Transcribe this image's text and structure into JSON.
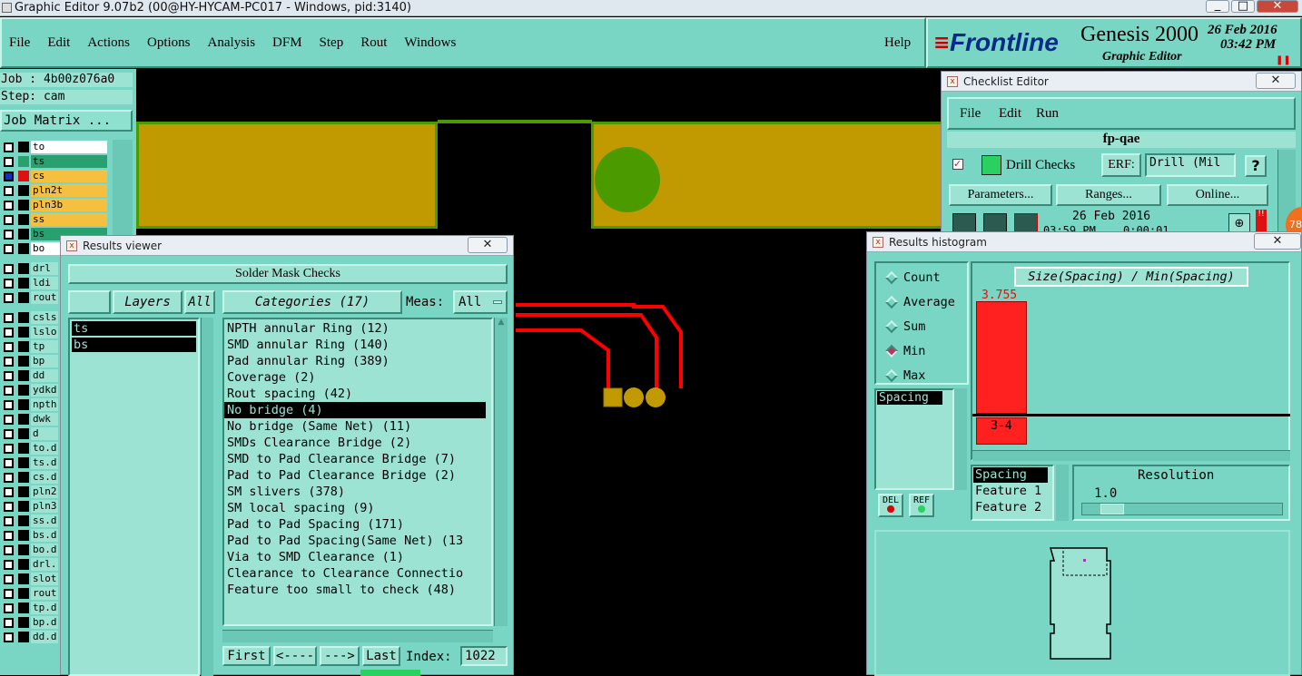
{
  "titlebar": {
    "title": "Graphic Editor 9.07b2 (00@HY-HYCAM-PC017 - Windows, pid:3140)"
  },
  "menubar": {
    "items": [
      "File",
      "Edit",
      "Actions",
      "Options",
      "Analysis",
      "DFM",
      "Step",
      "Rout",
      "Windows"
    ],
    "help": "Help"
  },
  "brand": {
    "logo": "Frontline",
    "product": "Genesis 2000",
    "subtitle": "Graphic Editor",
    "date": "26 Feb 2016",
    "time": "03:42 PM"
  },
  "job": {
    "job_label": "Job : 4b00z076a0",
    "step_label": "Step: cam",
    "matrix_button": "Job Matrix ..."
  },
  "layers": {
    "group1": [
      {
        "name": "to",
        "color": "#ffffff"
      },
      {
        "name": "ts",
        "color": "#2aa070"
      },
      {
        "name": "cs",
        "color": "#f5c040"
      },
      {
        "name": "pln2t",
        "color": "#f5c040"
      },
      {
        "name": "pln3b",
        "color": "#f5c040"
      },
      {
        "name": "ss",
        "color": "#f5c040"
      },
      {
        "name": "bs",
        "color": "#2aa070"
      },
      {
        "name": "bo",
        "color": "#ffffff"
      }
    ],
    "group2": [
      "drl",
      "ldi",
      "rout"
    ],
    "group3": [
      "csls",
      "lslo",
      "tp",
      "bp",
      "dd",
      "ydkd",
      "npth",
      "dwk",
      "d",
      "to.d",
      "ts.d",
      "cs.d",
      "pln2",
      "pln3",
      "ss.d",
      "bs.d",
      "bo.d",
      "drl.",
      "slot",
      "rout",
      "tp.d",
      "bp.d",
      "dd.d"
    ]
  },
  "results_viewer": {
    "title": "Results viewer",
    "close": "✕",
    "header": "Solder Mask Checks",
    "layers_label": "Layers",
    "all_label": "All",
    "layer_items": [
      "ts",
      "bs"
    ],
    "categories_label": "Categories (17)",
    "meas_label": "Meas:",
    "meas_value": "All",
    "categories": [
      "NPTH annular Ring (12)",
      "SMD annular Ring (140)",
      "Pad annular Ring (389)",
      "Coverage (2)",
      "Rout spacing (42)",
      "No bridge (4)",
      "No bridge (Same Net) (11)",
      "SMDs Clearance Bridge (2)",
      "SMD to Pad Clearance Bridge (7)",
      "Pad to Pad Clearance Bridge (2)",
      "SM slivers (378)",
      "SM local spacing (9)",
      "Pad to Pad Spacing (171)",
      "Pad to Pad Spacing(Same Net) (13",
      "Via to SMD Clearance (1)",
      "Clearance to Clearance Connectio",
      "Feature too small to check (48)"
    ],
    "selected_index": 5,
    "nav": {
      "first": "First",
      "prev": "<----",
      "next": "--->",
      "last": "Last",
      "index_label": "Index:",
      "index_value": "1022"
    }
  },
  "checklist": {
    "title": "Checklist Editor",
    "close": "✕",
    "menu": [
      "File",
      "Edit",
      "Run"
    ],
    "name": "fp-qae",
    "check_name": "Drill Checks",
    "erf_label": "ERF:",
    "erf_value": "Drill (Mil",
    "help": "?",
    "buttons": [
      "Parameters...",
      "Ranges...",
      "Online..."
    ],
    "date": "26 Feb 2016",
    "time": "03:59 PM",
    "duration": "0:00:01"
  },
  "histogram": {
    "title": "Results histogram",
    "close": "✕",
    "modes": [
      "Count",
      "Average",
      "Sum",
      "Min",
      "Max"
    ],
    "selected_mode": "Min",
    "left_list": [
      "Spacing"
    ],
    "chart_title": "Size(Spacing) / Min(Spacing)",
    "bar_value": "3.755",
    "bin_label": "3-4",
    "del": "DEL",
    "ref": "REF",
    "attrs": [
      "Spacing",
      "Feature 1",
      "Feature 2"
    ],
    "resolution_label": "Resolution",
    "resolution_value": "1.0"
  },
  "badge": {
    "text": "78"
  },
  "colors": {
    "panel": "#7ad6c4",
    "copper": "#c09a00",
    "pad_green": "#4a9a00",
    "trace_red": "#ff0000"
  }
}
